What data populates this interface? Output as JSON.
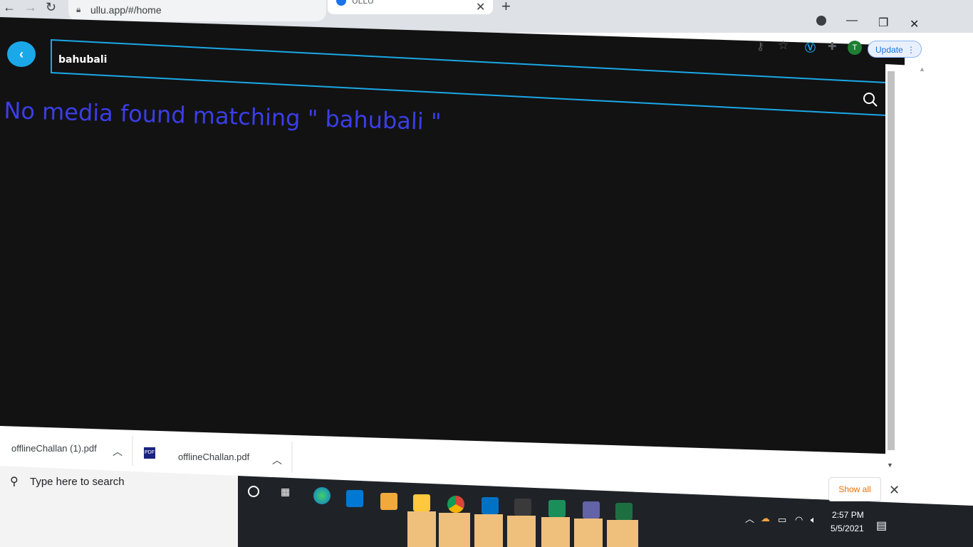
{
  "browser": {
    "url": "ullu.app/#/home",
    "tab_title": "ULLU",
    "update_label": "Update",
    "profile_initial": "T"
  },
  "page": {
    "search_value": "bahubali",
    "no_results_text": "No media found matching \" bahubali \""
  },
  "downloads": {
    "items": [
      {
        "name": "offlineChallan (1).pdf"
      },
      {
        "name": "offlineChallan.pdf"
      }
    ],
    "show_all_label": "Show all"
  },
  "taskbar": {
    "search_placeholder": "Type here to search",
    "time": "2:57 PM",
    "date": "5/5/2021"
  },
  "colors": {
    "page_bg": "#121212",
    "accent": "#1aa8e8",
    "message": "#3b3ee8",
    "taskbar": "#1f2328"
  }
}
